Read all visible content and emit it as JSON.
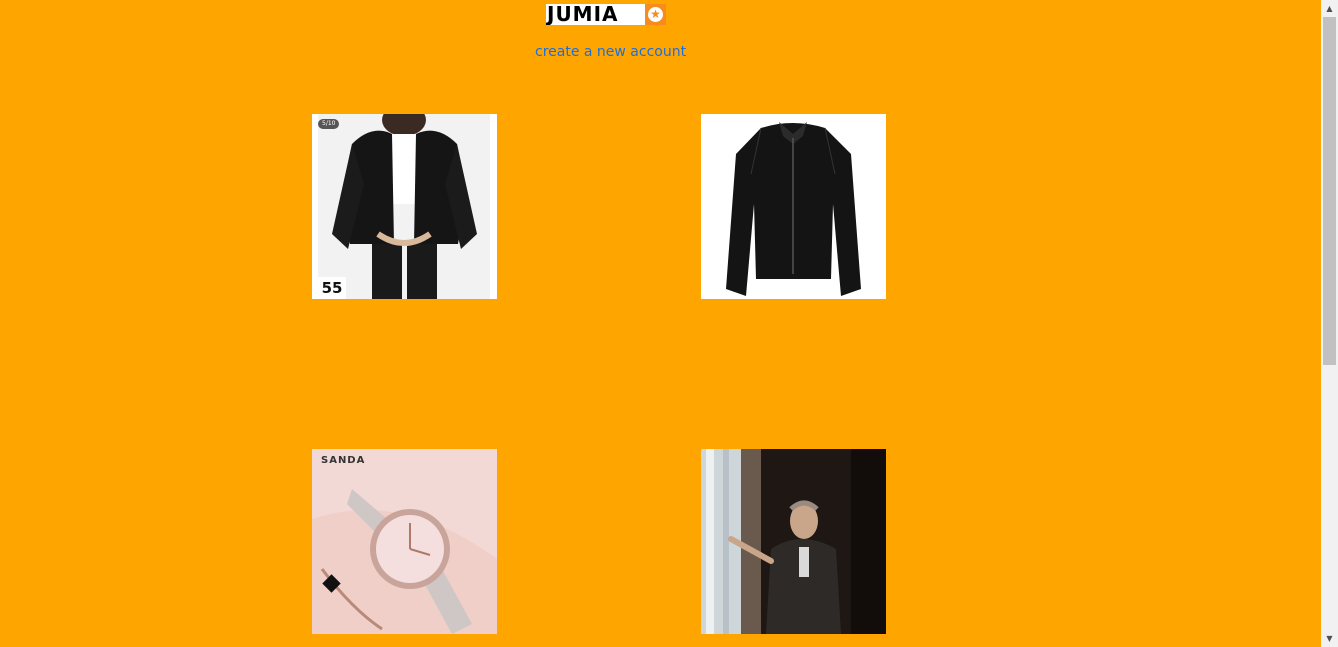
{
  "header": {
    "logo_text": "JUMIA",
    "logo_icon": "star-icon",
    "create_account_label": "create a new account"
  },
  "products": [
    {
      "description": "black fleece jacket",
      "badge": "55",
      "count": "5/10"
    },
    {
      "description": "black leather jacket"
    },
    {
      "description": "rose gold watch",
      "brand": "SANDA"
    },
    {
      "description": "man by window"
    }
  ],
  "colors": {
    "page_background": "#ffa500",
    "link": "#1a6fe0",
    "logo_badge": "#f68b1e"
  },
  "scrollbar": {
    "up_icon": "chevron-up-icon",
    "down_icon": "chevron-down-icon"
  }
}
